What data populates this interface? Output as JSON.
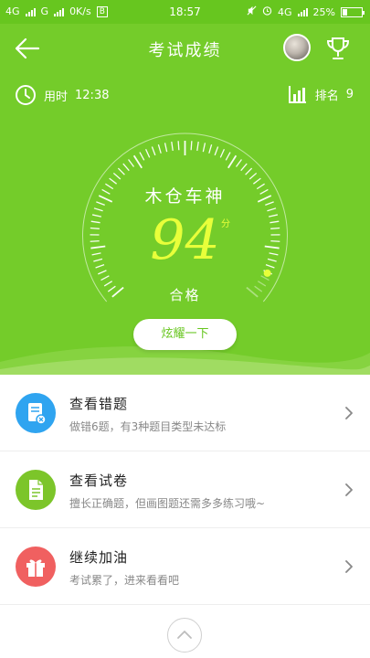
{
  "status_bar": {
    "network1": "4G",
    "network2": "G",
    "speed": "0K/s",
    "time": "18:57",
    "network3": "4G",
    "battery_percent": "25%",
    "battery_level": 0.25
  },
  "header": {
    "title": "考试成绩",
    "time_label": "用时",
    "time_value": "12:38",
    "rank_label": "排名",
    "rank_value": "9"
  },
  "score_card": {
    "nickname": "木仓车神",
    "score": "94",
    "score_unit": "分",
    "verdict": "合格",
    "gauge_level": 0.94,
    "show_button": "炫耀一下"
  },
  "list": {
    "items": [
      {
        "title": "查看错题",
        "subtitle": "做错6题，有3种题目类型未达标",
        "icon": "note-error-icon",
        "color": "#2fa4f0"
      },
      {
        "title": "查看试卷",
        "subtitle": "擅长正确题，但画图题还需多多练习哦~",
        "icon": "document-icon",
        "color": "#7cc52a"
      },
      {
        "title": "继续加油",
        "subtitle": "考试累了，进来看看吧",
        "icon": "gift-icon",
        "color": "#f06060"
      }
    ]
  },
  "colors": {
    "header_green": "#74cc2a",
    "score_yellow": "#e8ff3a"
  }
}
